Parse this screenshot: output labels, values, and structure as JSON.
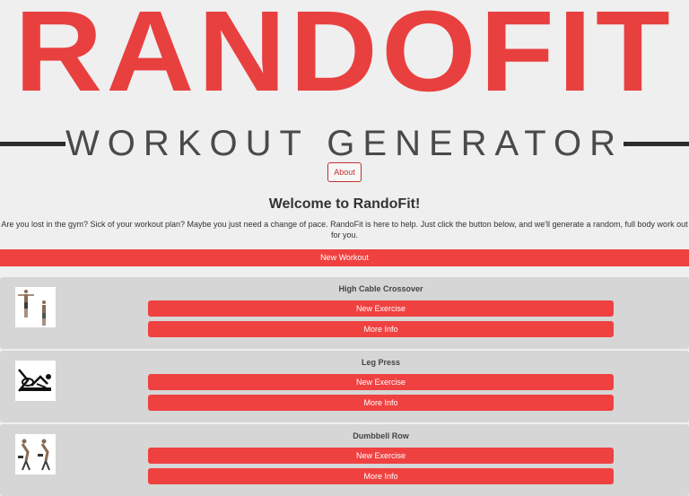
{
  "logo": {
    "title": "RANDOFIT",
    "subtitle": "WORKOUT GENERATOR"
  },
  "about": {
    "label": "About"
  },
  "welcome": {
    "title": "Welcome to RandoFit!",
    "text": "Are you lost in the gym? Sick of your workout plan? Maybe you just need a change of pace. RandoFit is here to help. Just click the button below, and we'll generate a random, full body work out for you."
  },
  "new_workout_label": "New Workout",
  "exercises": [
    {
      "name": "High Cable Crossover",
      "new_label": "New Exercise",
      "info_label": "More Info"
    },
    {
      "name": "Leg Press",
      "new_label": "New Exercise",
      "info_label": "More Info"
    },
    {
      "name": "Dumbbell Row",
      "new_label": "New Exercise",
      "info_label": "More Info"
    }
  ],
  "colors": {
    "accent": "#ef4140",
    "logo_red": "#e8403f",
    "card_bg": "#d6d6d6",
    "page_bg": "#efefef"
  }
}
